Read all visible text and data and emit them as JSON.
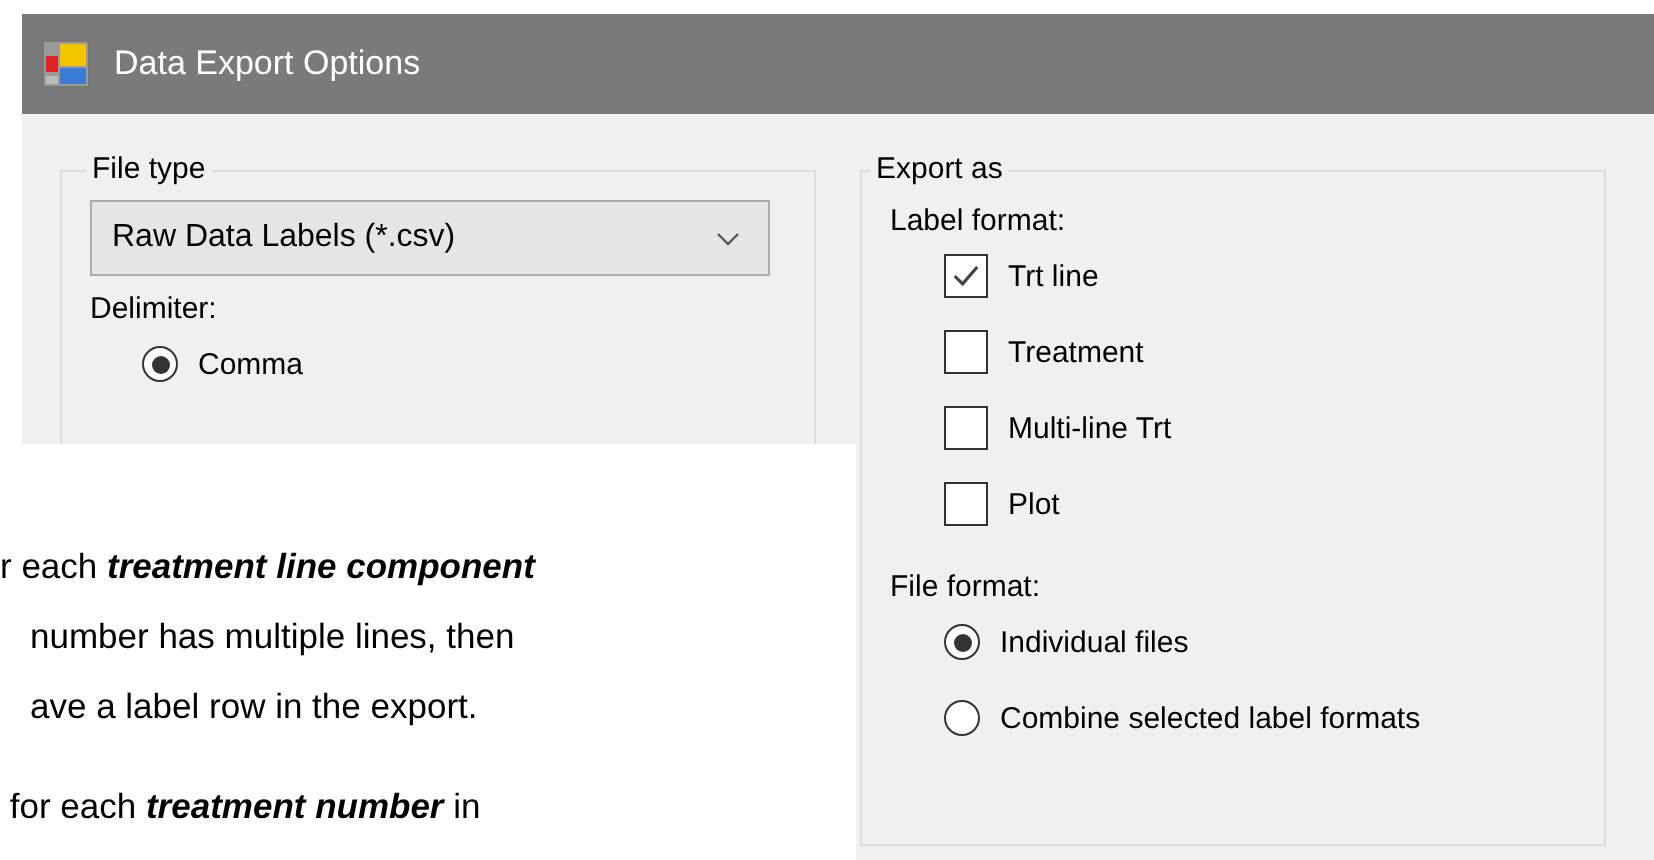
{
  "window": {
    "title": "Data Export Options"
  },
  "file_type": {
    "legend": "File type",
    "dropdown": {
      "value": "Raw Data Labels (*.csv)"
    },
    "delimiter_label": "Delimiter:",
    "delimiter_options": [
      {
        "label": "Comma",
        "selected": true
      }
    ]
  },
  "export_as": {
    "legend": "Export as",
    "label_format_label": "Label format:",
    "label_formats": [
      {
        "label": "Trt line",
        "checked": true
      },
      {
        "label": "Treatment",
        "checked": false
      },
      {
        "label": "Multi-line Trt",
        "checked": false
      },
      {
        "label": "Plot",
        "checked": false
      }
    ],
    "file_format_label": "File format:",
    "file_formats": [
      {
        "label": "Individual files",
        "selected": true
      },
      {
        "label": "Combine selected label formats",
        "selected": false
      }
    ]
  },
  "document_overlay": {
    "paragraphs": [
      [
        "r each **treatment line component**",
        "number has multiple lines, then",
        "ave a label row in the export."
      ],
      [
        " for each **treatment number** in"
      ]
    ]
  }
}
